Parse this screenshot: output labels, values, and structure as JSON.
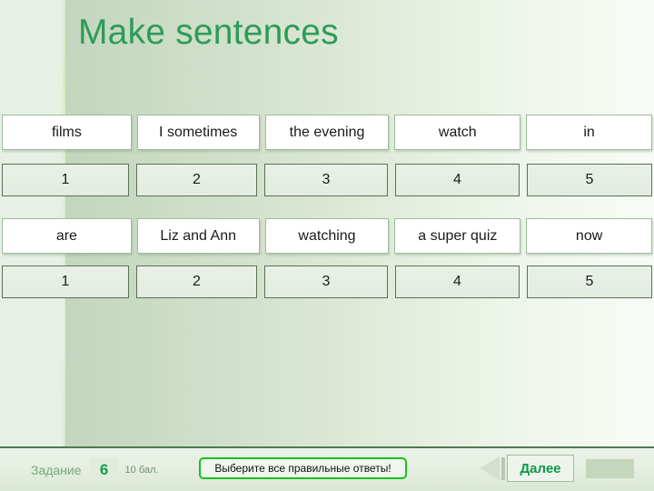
{
  "slide": {
    "title": "Make sentences"
  },
  "exercises": [
    {
      "words": [
        "films",
        "I sometimes",
        "the evening",
        "watch",
        "in"
      ],
      "numbers": [
        "1",
        "2",
        "3",
        "4",
        "5"
      ]
    },
    {
      "words": [
        "are",
        "Liz and Ann",
        "watching",
        "a super quiz",
        "now"
      ],
      "numbers": [
        "1",
        "2",
        "3",
        "4",
        "5"
      ]
    }
  ],
  "statusbar": {
    "task_label": "Задание",
    "task_number": "6",
    "points": "10 бал.",
    "prompt": "Выберите все правильные ответы!",
    "back_icon": "triangle-left-icon",
    "next_label": "Далее"
  },
  "colors": {
    "title_green": "#2d9c59",
    "accent_green": "#13c21c",
    "progress_green": "#c4d6bc"
  }
}
